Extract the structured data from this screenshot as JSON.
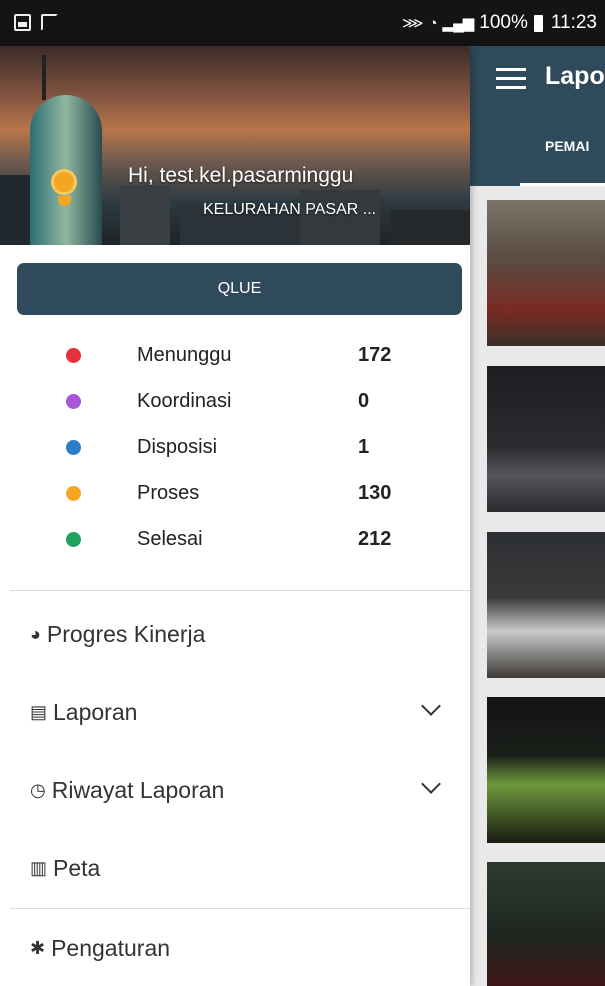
{
  "status_bar": {
    "signal_text": "100%",
    "time": "11:23"
  },
  "app": {
    "title": "Lapo",
    "tab": "PEMAI"
  },
  "drawer": {
    "greeting": "Hi, test.kel.pasarminggu",
    "kelurahan": "KELURAHAN PASAR ...",
    "qlue_button": "QLUE",
    "stats": [
      {
        "label": "Menunggu",
        "value": "172",
        "color": "#e8303a"
      },
      {
        "label": "Koordinasi",
        "value": "0",
        "color": "#a855d8"
      },
      {
        "label": "Disposisi",
        "value": "1",
        "color": "#2a7fc6"
      },
      {
        "label": "Proses",
        "value": "130",
        "color": "#f6a623"
      },
      {
        "label": "Selesai",
        "value": "212",
        "color": "#1fa35c"
      }
    ],
    "menu": [
      {
        "label": "Progres Kinerja",
        "icon": "pie-chart-icon"
      },
      {
        "label": "Laporan",
        "icon": "list-icon"
      },
      {
        "label": "Riwayat Laporan",
        "icon": "history-icon"
      },
      {
        "label": "Peta",
        "icon": "map-icon"
      },
      {
        "label": "Pengaturan",
        "icon": "gear-icon"
      }
    ]
  }
}
